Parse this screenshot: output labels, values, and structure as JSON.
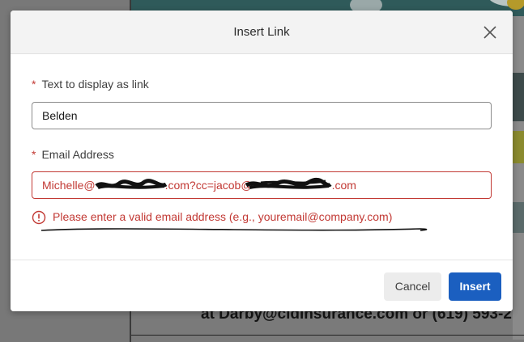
{
  "modal": {
    "title": "Insert Link",
    "close_icon": "close-icon",
    "fields": {
      "display_text": {
        "required_marker": "*",
        "label": "Text to display as link",
        "value": "Belden"
      },
      "email": {
        "required_marker": "*",
        "label": "Email Address",
        "value_prefix": "Michelle@",
        "value_mid": ".com?cc=jacob@",
        "value_suffix": ".com",
        "error_icon": "error-circle-icon",
        "error_message": "Please enter a valid email address (e.g., youremail@company.com)"
      }
    },
    "buttons": {
      "cancel": "Cancel",
      "insert": "Insert"
    }
  },
  "background": {
    "footer_text": "at Darby@cidinsurance.com or (619) 593-2"
  },
  "colors": {
    "error": "#c23934",
    "primary": "#1b5fc0",
    "header_bg": "#f3f3f3"
  }
}
